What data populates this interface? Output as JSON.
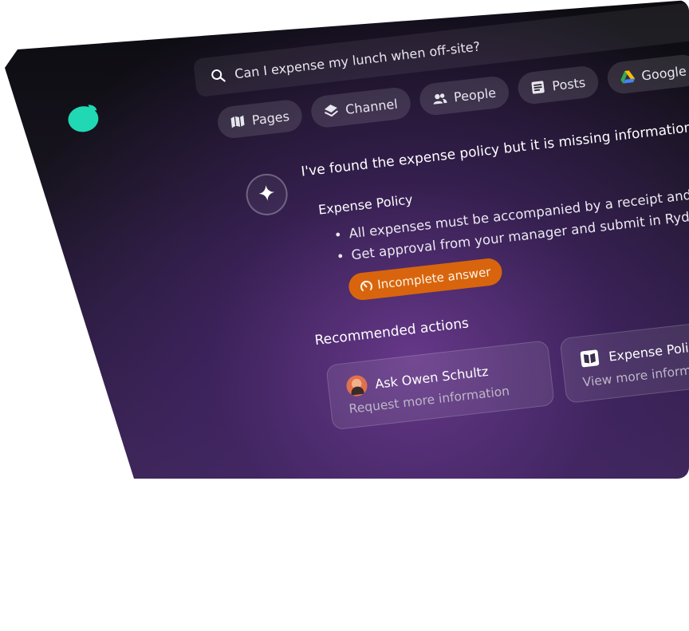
{
  "search": {
    "query": "Can I expense my lunch when off-site?"
  },
  "filters": [
    {
      "label": "Pages",
      "icon": "map-icon"
    },
    {
      "label": "Channel",
      "icon": "layers-icon"
    },
    {
      "label": "People",
      "icon": "people-icon"
    },
    {
      "label": "Posts",
      "icon": "post-icon"
    },
    {
      "label": "Google",
      "icon": "google-drive-icon"
    }
  ],
  "answer": {
    "intro": "I've found the expense policy but it is missing information a",
    "policy_title": "Expense Policy",
    "bullets": [
      "All expenses must be accompanied by a receipt and des",
      "Get approval from your manager and submit in Rydoo"
    ],
    "status_badge": "Incomplete answer"
  },
  "recommended": {
    "title": "Recommended actions",
    "cards": [
      {
        "title": "Ask Owen Schultz",
        "subtitle": "Request more information"
      },
      {
        "title": "Expense Policy",
        "subtitle": "View more information"
      }
    ]
  },
  "colors": {
    "brand": "#1fd6b6",
    "badge": "#d8650d",
    "background": "#17141e"
  }
}
